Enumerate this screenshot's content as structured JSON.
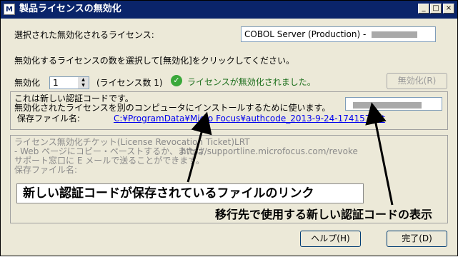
{
  "window": {
    "title": "製品ライセンスの無効化",
    "app_icon": "M",
    "buttons": {
      "minimize": "_",
      "maximize": "□",
      "close": "×"
    }
  },
  "license_select": {
    "label": "選択された無効化されるライセンス:",
    "value": "COBOL Server (Production) - "
  },
  "instruction": "無効化するライセンスの数を選択して[無効化]をクリックしてください。",
  "deactivate_row": {
    "label": "無効化",
    "count_value": "1",
    "license_count_text": "(ライセンス数 1)",
    "status_text": "ライセンスが無効化されました。",
    "button_label": "無効化(R)"
  },
  "auth_code_group": {
    "line1": "これは新しい認証コードです。",
    "line2": "無効化されたライセンスを別のコンピュータにインストールするために使います。",
    "file_label": "保存ファイル名:",
    "file_link": "C:¥ProgramData¥Micro Focus¥authcode_2013-9-24-174157.txt"
  },
  "revocation_group": {
    "line1": "ライセンス無効化チケット(License Revocation Ticket)LRT",
    "line2": "- Web ページにコピー・ペーストするか、または",
    "url": "http://supportline.microfocus.com/revoke",
    "line3": "サポート窓口に E メールで送ることができます。",
    "file_label": "保存ファイル名:"
  },
  "annotations": {
    "link_note": "新しい認証コードが保存されているファイルのリンク",
    "code_note": "移行先で使用する新しい認証コードの表示"
  },
  "footer": {
    "help_button": "ヘルプ(H)",
    "done_button": "完了(D)"
  },
  "icons": {
    "check": "✓",
    "spin_up": "▲",
    "spin_down": "▼"
  },
  "colors": {
    "titlebar": "#0a246a",
    "link": "#0000ee",
    "status_green": "#3aa83a"
  }
}
